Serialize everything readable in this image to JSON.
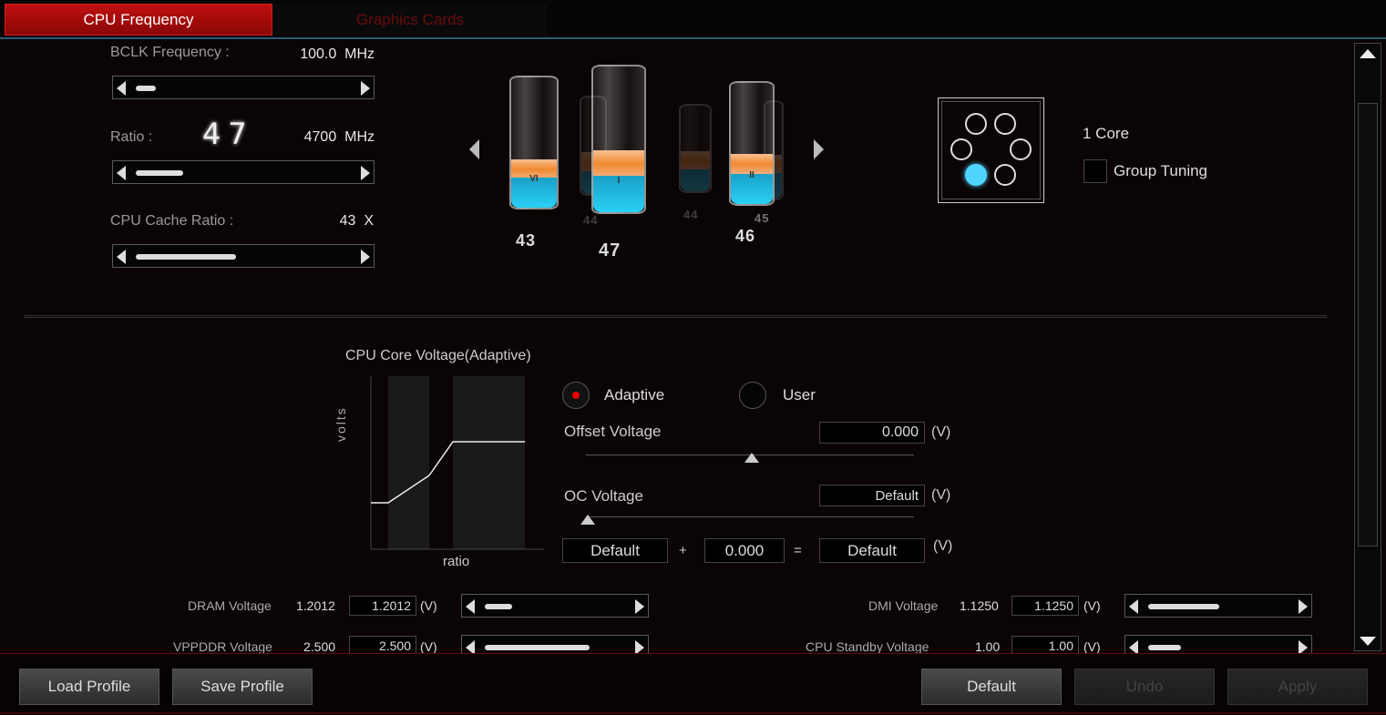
{
  "tabs": [
    {
      "label": "CPU Frequency",
      "active": true
    },
    {
      "label": "Graphics Cards",
      "active": false
    }
  ],
  "colors": {
    "accent": "#b00a0a",
    "liquid_blue": "#2ad0f5",
    "liquid_orange": "#f08a30",
    "selected_core": "#4fd4ff"
  },
  "frequency": {
    "bclk_label": "BCLK Frequency :",
    "bclk_value": "100.0  MHz",
    "bclk_slider_percent": 5,
    "ratio_label": "Ratio :",
    "ratio_big": "47",
    "ratio_value": "4700  MHz",
    "ratio_slider_percent": 20,
    "cache_label": "CPU Cache Ratio :",
    "cache_value": "43  X",
    "cache_slider_percent": 42
  },
  "cores": {
    "cylinders": [
      {
        "ratio": "43",
        "numeral": "VI"
      },
      {
        "ratio": "44",
        "ghost": true
      },
      {
        "ratio": "47",
        "numeral": "I"
      },
      {
        "ratio": "44",
        "ghost": true
      },
      {
        "ratio": "45",
        "ghost": true
      },
      {
        "ratio": "46",
        "numeral": "II"
      }
    ],
    "core_count_label": "1 Core",
    "group_tuning_label": "Group Tuning",
    "group_tuning_checked": false,
    "selected_core_index": 4
  },
  "voltage": {
    "title": "CPU Core Voltage(Adaptive)",
    "y_axis": "volts",
    "x_axis": "ratio",
    "mode_adaptive": "Adaptive",
    "mode_user": "User",
    "selected_mode": "Adaptive",
    "offset_label": "Offset Voltage",
    "offset_value": "0.000",
    "unit": "(V)",
    "oc_label": "OC Voltage",
    "oc_value": "Default",
    "sum_a": "Default",
    "plus": "+",
    "sum_b": "0.000",
    "equals": "=",
    "sum_result": "Default"
  },
  "rails": [
    {
      "label": "DRAM Voltage",
      "current": "1.2012",
      "input": "1.2012",
      "unit": "(V)",
      "slider_percent": 10
    },
    {
      "label": "DMI Voltage",
      "current": "1.1250",
      "input": "1.1250",
      "unit": "(V)",
      "slider_percent": 40
    },
    {
      "label": "VPPDDR Voltage",
      "current": "2.500",
      "input": "2.500",
      "unit": "(V)",
      "slider_percent": 65
    },
    {
      "label": "CPU Standby Voltage",
      "current": "1.00",
      "input": "1.00",
      "unit": "(V)",
      "slider_percent": 15
    }
  ],
  "footer": {
    "load": "Load Profile",
    "save": "Save Profile",
    "default": "Default",
    "undo": "Undo",
    "apply": "Apply"
  }
}
